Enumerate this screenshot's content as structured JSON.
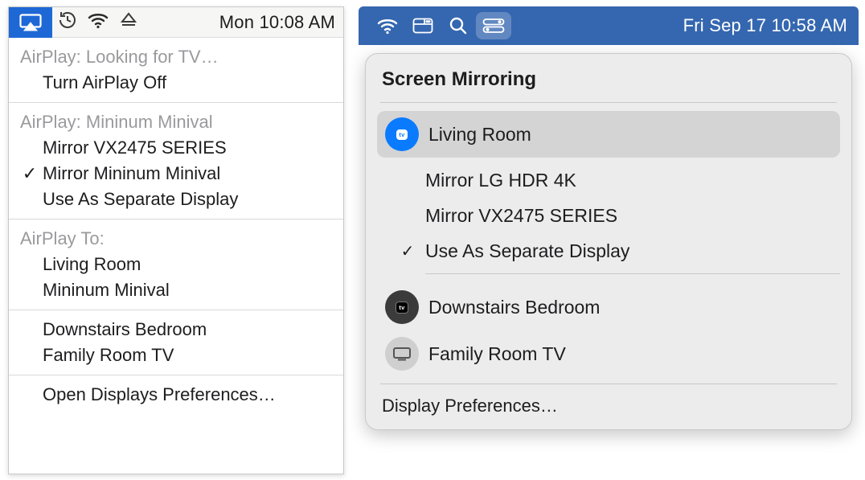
{
  "left": {
    "menubar": {
      "clock": "Mon 10:08 AM"
    },
    "group1": {
      "label": "AirPlay: Looking for TV…",
      "turn_off": "Turn AirPlay Off"
    },
    "group2": {
      "label": "AirPlay: Mininum Minival",
      "mirror1": "Mirror VX2475 SERIES",
      "mirror2": "Mirror Mininum Minival",
      "separate": "Use As Separate Display"
    },
    "group3": {
      "label": "AirPlay To:",
      "dest1": "Living Room",
      "dest2": "Mininum Minival"
    },
    "group4": {
      "item1": "Downstairs Bedroom",
      "item2": "Family Room TV"
    },
    "footer": "Open Displays Preferences…"
  },
  "right": {
    "menubar": {
      "clock": "Fri Sep 17  10:58 AM"
    },
    "title": "Screen Mirroring",
    "selected": {
      "label": "Living Room",
      "subs": {
        "sub1": "Mirror LG HDR 4K",
        "sub2": "Mirror VX2475 SERIES",
        "sub3": "Use As Separate Display"
      }
    },
    "dest2": "Downstairs Bedroom",
    "dest3": "Family Room TV",
    "footer": "Display Preferences…"
  }
}
